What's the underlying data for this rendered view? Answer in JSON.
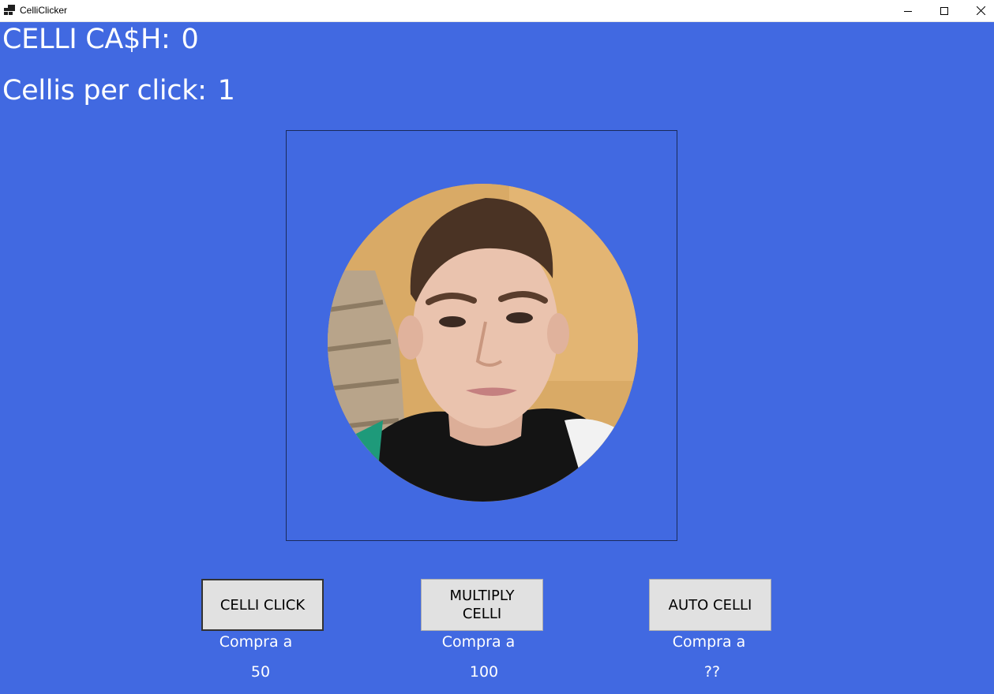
{
  "window": {
    "title": "CelliClicker",
    "icon": "app-window-icon",
    "controls": [
      "minimize-icon",
      "maximize-icon",
      "close-icon"
    ]
  },
  "stats": {
    "cash_label": "CELLI CA$H:",
    "cash_value": "0",
    "per_click_label": "Cellis per click:",
    "per_click_value": "1"
  },
  "clicker": {
    "image": "portrait photo of a young man"
  },
  "shop": {
    "items": [
      {
        "button": "CELLI CLICK",
        "price_label": "Compra a",
        "price": "50"
      },
      {
        "button": "MULTIPLY CELLI",
        "price_label": "Compra a",
        "price": "100"
      },
      {
        "button": "AUTO CELLI",
        "price_label": "Compra a",
        "price": "??"
      }
    ]
  },
  "colors": {
    "background": "#4169e1",
    "button_face": "#e1e1e1",
    "text": "#ffffff"
  }
}
